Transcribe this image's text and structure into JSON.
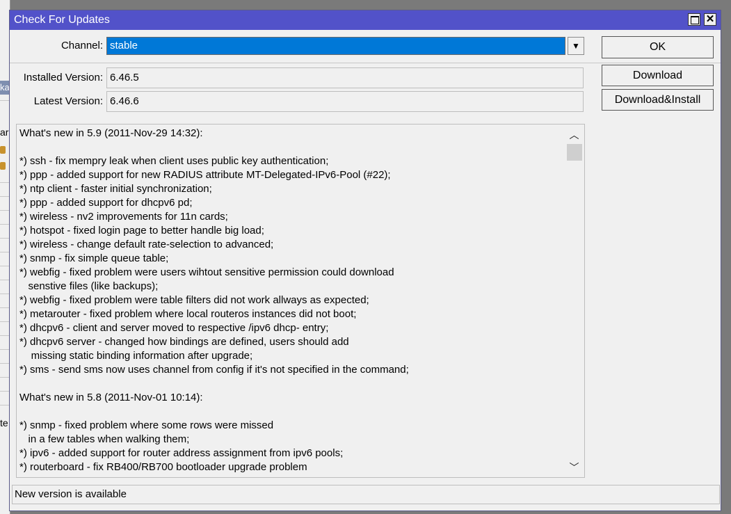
{
  "background_window": {
    "tab_label": "ka",
    "col_label": "ar",
    "cell_label": "te"
  },
  "window": {
    "title": "Check For Updates",
    "channel_label": "Channel:",
    "channel_value": "stable",
    "installed_label": "Installed Version:",
    "installed_value": "6.46.5",
    "latest_label": "Latest Version:",
    "latest_value": "6.46.6",
    "changelog": "What's new in 5.9 (2011-Nov-29 14:32):\n\n*) ssh - fix memprу leak when client uses public key authentication;\n*) ppp - added support for new RADIUS attribute MT-Delegated-IPv6-Pool (#22);\n*) ntp client - faster initial synchronization;\n*) ppp - added support for dhcpv6 pd;\n*) wireless - nv2 improvements for 11n cards;\n*) hotspot - fixed login page to better handle big load;\n*) wireless - change default rate-selection to advanced;\n*) snmp - fix simple queue table;\n*) webfig - fixed problem were users wihtout sensitive permission could download\n   senstive files (like backups);\n*) webfig - fixed problem were table filters did not work allways as expected;\n*) metarouter - fixed problem where local routeros instances did not boot;\n*) dhcpv6 - client and server moved to respective /ipv6 dhcp- entry;\n*) dhcpv6 server - changed how bindings are defined, users should add\n    missing static binding information after upgrade;\n*) sms - send sms now uses channel from config if it's not specified in the command;\n\nWhat's new in 5.8 (2011-Nov-01 10:14):\n\n*) snmp - fixed problem where some rows were missed\n   in a few tables when walking them;\n*) ipv6 - added support for router address assignment from ipv6 pools;\n*) routerboard - fix RB400/RB700 bootloader upgrade problem",
    "status": "New version is available"
  },
  "buttons": {
    "ok": "OK",
    "download": "Download",
    "download_install": "Download&Install"
  },
  "icons": {
    "maximize": "maximize-icon",
    "close": "close-icon",
    "dropdown": "dropdown-arrow-icon",
    "scroll_up": "scroll-up-icon",
    "scroll_down": "scroll-down-icon"
  },
  "colors": {
    "titlebar": "#5252c9",
    "selection": "#0078d7",
    "window_bg": "#f0f0f0"
  }
}
